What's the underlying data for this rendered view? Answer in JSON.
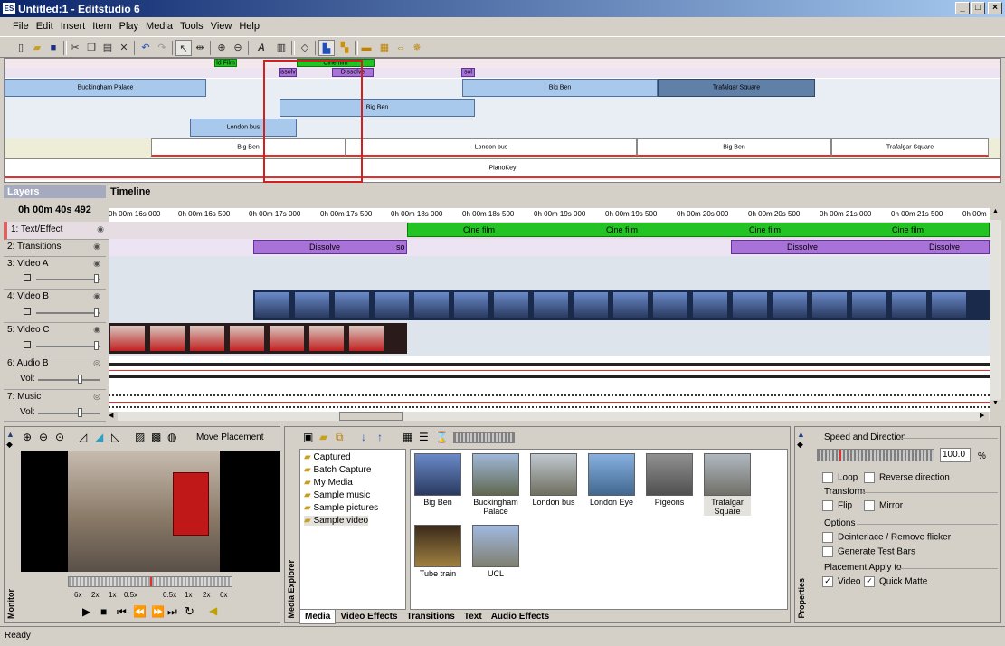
{
  "window": {
    "title": "Untitled:1 - Editstudio 6",
    "app_icon_label": "ES"
  },
  "menu": [
    "File",
    "Edit",
    "Insert",
    "Item",
    "Play",
    "Media",
    "Tools",
    "View",
    "Help"
  ],
  "overview": {
    "rows": [
      {
        "row": "text",
        "blocks": [
          {
            "label": "ld Film",
            "color": "#22c322"
          },
          {
            "label": "Cine film",
            "color": "#22c322"
          }
        ]
      },
      {
        "row": "transitions",
        "blocks": [
          {
            "label": "issolv",
            "color": "#a872d8"
          },
          {
            "label": "Dissolve",
            "color": "#a872d8"
          },
          {
            "label": "sol",
            "color": "#a872d8"
          }
        ]
      },
      {
        "row": "videoA",
        "blocks": [
          {
            "label": "Buckingham Palace"
          },
          {
            "label": "Big Ben"
          },
          {
            "label": "Trafalgar Square"
          }
        ]
      },
      {
        "row": "videoB",
        "blocks": [
          {
            "label": "Big Ben"
          }
        ]
      },
      {
        "row": "videoC",
        "blocks": [
          {
            "label": "London bus"
          }
        ]
      },
      {
        "row": "audio",
        "blocks": [
          {
            "label": "Big Ben"
          },
          {
            "label": "London bus"
          },
          {
            "label": "Big Ben"
          },
          {
            "label": "Trafalgar Square"
          }
        ]
      },
      {
        "row": "music",
        "blocks": [
          {
            "label": "PianoKey"
          }
        ]
      }
    ]
  },
  "layers": {
    "header": "Layers",
    "time": "0h 00m 40s 492",
    "items": [
      {
        "label": "1: Text/Effect"
      },
      {
        "label": "2: Transitions"
      },
      {
        "label": "3: Video A"
      },
      {
        "label": "4: Video B"
      },
      {
        "label": "5: Video C"
      },
      {
        "label": "6: Audio B",
        "vol": "Vol:"
      },
      {
        "label": "7: Music",
        "vol": "Vol:"
      }
    ]
  },
  "timeline": {
    "header": "Timeline",
    "ticks": [
      "0h 00m 16s 000",
      "0h 00m 16s 500",
      "0h 00m 17s 000",
      "0h 00m 17s 500",
      "0h 00m 18s 000",
      "0h 00m 18s 500",
      "0h 00m 19s 000",
      "0h 00m 19s 500",
      "0h 00m 20s 000",
      "0h 00m 20s 500",
      "0h 00m 21s 000",
      "0h 00m 21s 500",
      "0h 00m"
    ],
    "text_track": [
      "Cine film",
      "Cine film",
      "Cine film",
      "Cine film"
    ],
    "transition_track": [
      "Dissolve",
      "so",
      "Dissolve",
      "Dissolve"
    ]
  },
  "monitor": {
    "label": "Monitor",
    "placement_label": "Move Placement",
    "speeds": [
      "6x",
      "2x",
      "1x",
      "0.5x",
      "0.5x",
      "1x",
      "2x",
      "6x"
    ]
  },
  "media_explorer": {
    "label": "Media Explorer",
    "folders": [
      "Captured",
      "Batch Capture",
      "My Media",
      "Sample music",
      "Sample pictures",
      "Sample video"
    ],
    "selected_folder": "Sample video",
    "thumbs": [
      "Big Ben",
      "Buckingham Palace",
      "London bus",
      "London Eye",
      "Pigeons",
      "Trafalgar Square",
      "Tube train",
      "UCL"
    ],
    "tabs": [
      "Media",
      "Video Effects",
      "Transitions",
      "Text",
      "Audio Effects"
    ]
  },
  "properties": {
    "label": "Properties",
    "speed_title": "Speed and Direction",
    "speed_value": "100.0",
    "speed_unit": "%",
    "loop": "Loop",
    "reverse": "Reverse direction",
    "transform_title": "Transform",
    "flip": "Flip",
    "mirror": "Mirror",
    "options_title": "Options",
    "deinterlace": "Deinterlace / Remove flicker",
    "testbars": "Generate Test Bars",
    "placement_title": "Placement Apply to",
    "video": "Video",
    "quickmatte": "Quick Matte"
  },
  "status": "Ready"
}
